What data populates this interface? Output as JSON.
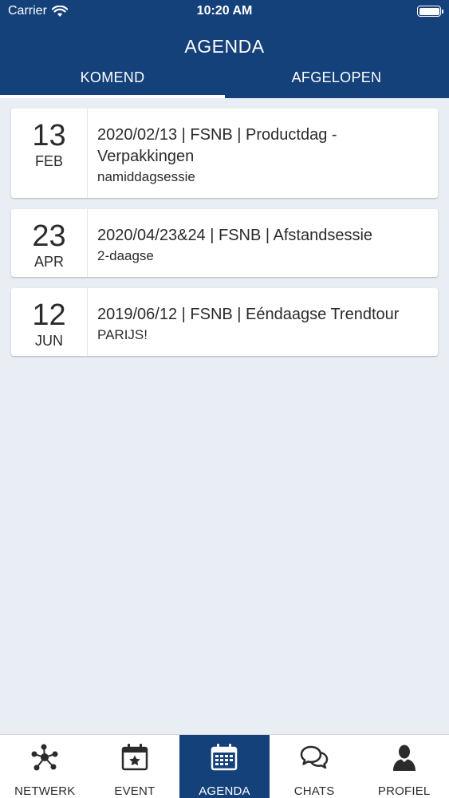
{
  "status_bar": {
    "carrier": "Carrier",
    "time": "10:20 AM"
  },
  "header": {
    "title": "AGENDA"
  },
  "tabs": [
    {
      "label": "KOMEND",
      "active": true
    },
    {
      "label": "AFGELOPEN",
      "active": false
    }
  ],
  "events": [
    {
      "day": "13",
      "month": "FEB",
      "title": "2020/02/13 | FSNB | Productdag - Verpakkingen",
      "subtitle": "namiddagsessie"
    },
    {
      "day": "23",
      "month": "APR",
      "title": "2020/04/23&24 | FSNB | Afstandsessie",
      "subtitle": "2-daagse"
    },
    {
      "day": "12",
      "month": "JUN",
      "title": "2019/06/12 | FSNB | Eéndaagse Trendtour",
      "subtitle": "PARIJS!"
    }
  ],
  "tabbar": {
    "items": [
      {
        "label": "NETWERK",
        "icon": "network-icon"
      },
      {
        "label": "EVENT",
        "icon": "calendar-star-icon"
      },
      {
        "label": "AGENDA",
        "icon": "calendar-grid-icon",
        "active": true
      },
      {
        "label": "CHATS",
        "icon": "chat-bubbles-icon"
      },
      {
        "label": "PROFIEL",
        "icon": "person-icon"
      }
    ]
  },
  "colors": {
    "primary": "#15417a",
    "background": "#e9edf4",
    "card": "#ffffff"
  }
}
